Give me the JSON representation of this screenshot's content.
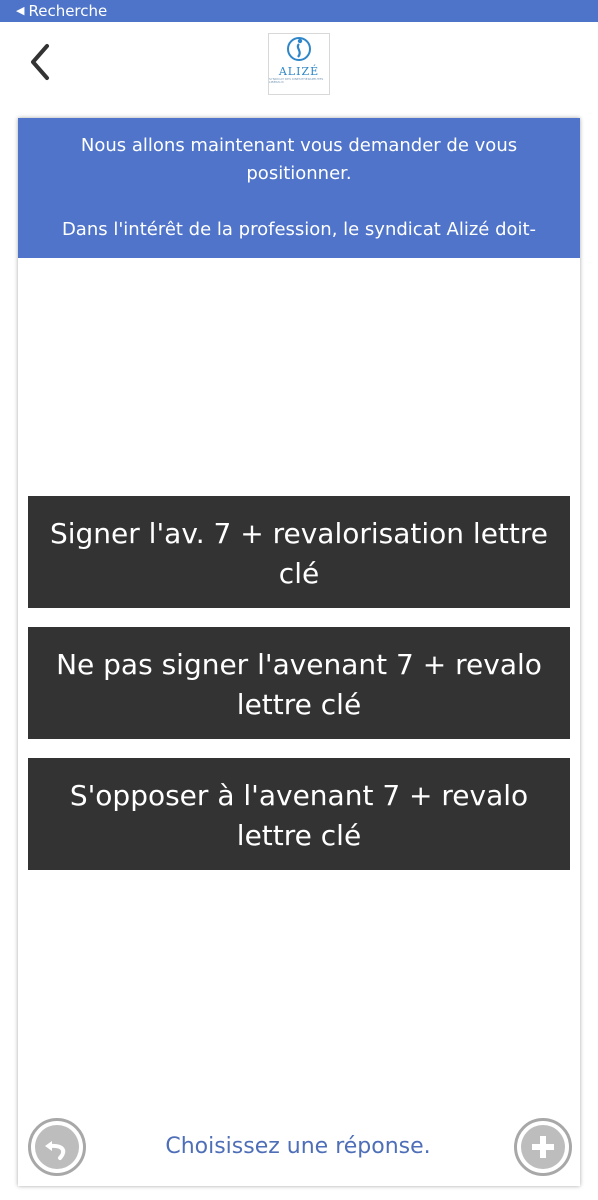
{
  "status_bar": {
    "back_label": "Recherche"
  },
  "nav": {
    "logo_text": "ALIZÉ",
    "logo_tagline": "SYNDICAT DES KINÉSITHÉRAPEUTES LIBÉRAUX"
  },
  "header": {
    "line1": "Nous allons maintenant vous demander de vous positionner.",
    "line2": "Dans l'intérêt de la profession, le syndicat Alizé doit-"
  },
  "options": [
    {
      "label": "Signer l'av. 7 + revalorisation lettre clé"
    },
    {
      "label": "Ne pas signer l'avenant 7 + revalo lettre clé"
    },
    {
      "label": "S'opposer à l'avenant 7 + revalo lettre clé"
    }
  ],
  "footer": {
    "prompt": "Choisissez une réponse."
  },
  "colors": {
    "accent": "#4f74c9",
    "option_bg": "#333333",
    "prompt_text": "#4e6fb8"
  },
  "icons": {
    "status_back": "triangle-left-icon",
    "nav_back": "chevron-left-icon",
    "undo": "undo-arrow-icon",
    "add": "plus-icon"
  }
}
